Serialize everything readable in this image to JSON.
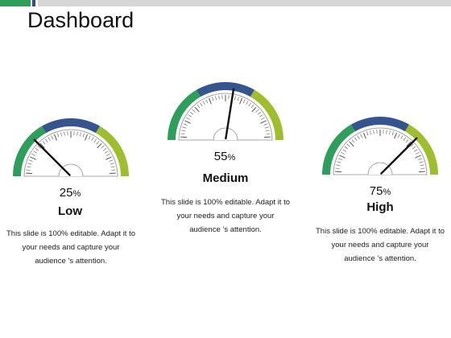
{
  "title": "Dashboard",
  "gauges": [
    {
      "id": "low",
      "value": 25,
      "percent_symbol": "%",
      "label": "Low",
      "description": "This slide is 100% editable. Adapt it to your needs and capture your audience ’s attention."
    },
    {
      "id": "medium",
      "value": 55,
      "percent_symbol": "%",
      "label": "Medium",
      "description": "This slide is 100% editable. Adapt it to your needs and capture your audience ’s attention."
    },
    {
      "id": "high",
      "value": 75,
      "percent_symbol": "%",
      "label": "High",
      "description": "This slide is 100% editable. Adapt it to your needs and capture your audience ’s attention."
    }
  ],
  "colors": {
    "green": "#2e9e5b",
    "navy": "#34558f",
    "olive": "#9ebe2e",
    "needle": "#111111",
    "accent_bar": "#2e9e5b"
  },
  "icon_names": [
    "gauge-icon"
  ]
}
